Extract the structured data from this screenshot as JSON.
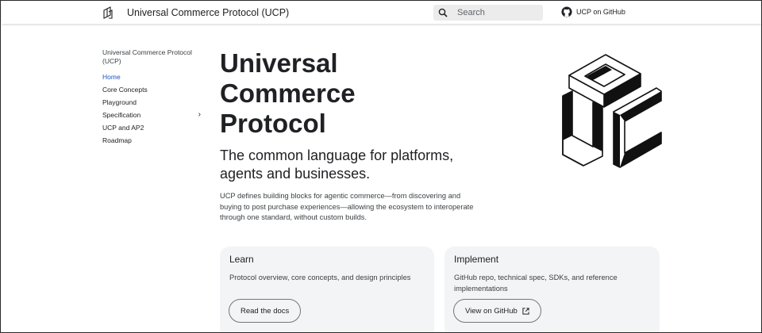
{
  "header": {
    "site_title": "Universal Commerce Protocol (UCP)",
    "search_placeholder": "Search",
    "github_link": "UCP on GitHub"
  },
  "sidebar": {
    "title": "Universal Commerce Protocol (UCP)",
    "items": [
      {
        "label": "Home",
        "active": true
      },
      {
        "label": "Core Concepts"
      },
      {
        "label": "Playground"
      },
      {
        "label": "Specification",
        "icon": "chevron-right-icon"
      },
      {
        "label": "UCP and AP2"
      },
      {
        "label": "Roadmap"
      }
    ]
  },
  "hero": {
    "title_lines": [
      "Universal",
      "Commerce",
      "Protocol"
    ],
    "subtitle": "The common language for platforms, agents and businesses.",
    "description": "UCP defines building blocks for agentic commerce—from discovering and buying to post purchase experiences—allowing the ecosystem to interoperate through one standard, without custom builds."
  },
  "cards": {
    "learn": {
      "title": "Learn",
      "text": "Protocol overview, core concepts, and design principles",
      "button": "Read the docs"
    },
    "implement": {
      "title": "Implement",
      "text": "GitHub repo, technical spec, SDKs, and reference implementations",
      "button": "View on GitHub",
      "button_icon": "external-link-icon"
    }
  },
  "colors": {
    "active_link": "#1a56c9",
    "card_bg": "#f3f4f6",
    "search_bg": "#ececec"
  }
}
